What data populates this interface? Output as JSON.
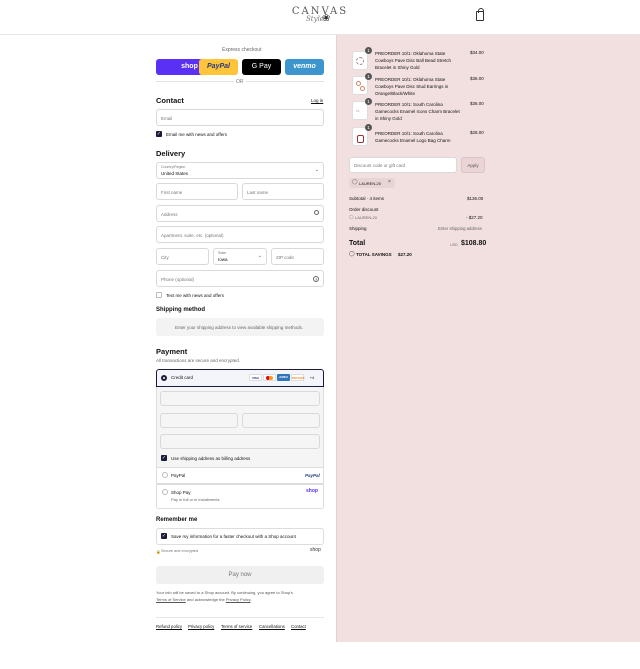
{
  "brand": {
    "logo_text": "CANVAS",
    "logo_sub": "Style"
  },
  "express": {
    "label": "Express checkout",
    "buttons": [
      "shop",
      "PayPal",
      "G Pay",
      "venmo"
    ],
    "or": "OR"
  },
  "contact": {
    "heading": "Contact",
    "login": "Log in",
    "email_placeholder": "Email",
    "email_news": "Email me with news and offers"
  },
  "delivery": {
    "heading": "Delivery",
    "country_label": "Country/Region",
    "country_value": "United States",
    "first_name": "First name",
    "last_name": "Last name",
    "address": "Address",
    "apartment": "Apartment, suite, etc. (optional)",
    "city": "City",
    "state_label": "State",
    "state_value": "Iowa",
    "zip": "ZIP code",
    "phone": "Phone (optional)",
    "text_news": "Text me with news and offers"
  },
  "shipping": {
    "heading": "Shipping method",
    "message": "Enter your shipping address to view available shipping methods."
  },
  "payment": {
    "heading": "Payment",
    "subtitle": "All transactions are secure and encrypted.",
    "credit_card": "Credit card",
    "more_cards": "+4",
    "card_brands": [
      "VISA",
      "MC",
      "AMEX",
      "DISCOVER"
    ],
    "billing_same": "Use shipping address as billing address",
    "paypal": "PayPal",
    "shop_pay": "Shop Pay",
    "shop_pay_sub": "Pay in full or in installments",
    "shop_logo": "shop"
  },
  "remember": {
    "heading": "Remember me",
    "save_info": "Save my information for a faster checkout with a Shop account",
    "secure": "Secure and encrypted",
    "shop": "shop"
  },
  "pay_now": "Pay now",
  "legal": {
    "line1": "Your info will be saved to a Shop account. By continuing, you agree to Shop's",
    "terms": "Terms of Service",
    "mid": " and acknowledge the ",
    "privacy": "Privacy Policy",
    "end": "."
  },
  "footer_links": [
    "Refund policy",
    "Privacy policy",
    "Terms of service",
    "Cancellations",
    "Contact"
  ],
  "cart": {
    "items": [
      {
        "qty": "1",
        "name1": "PREORDER 10/1: Oklahoma State",
        "name2": "Cowboys Pave Disc Ball Bead Stretch",
        "name3": "Bracelet in Shiny Gold",
        "price": "$34.00"
      },
      {
        "qty": "1",
        "name1": "PREORDER 10/1: Oklahoma State",
        "name2": "Cowboys Pave Disc Stud Earrings in",
        "name3": "Orange/Black/White",
        "price": "$36.00"
      },
      {
        "qty": "1",
        "name1": "PREORDER 10/1: South Carolina",
        "name2": "Gamecocks Enamel Icons Charm Bracelet",
        "name3": "in Shiny Gold",
        "price": "$36.00"
      },
      {
        "qty": "1",
        "name1": "PREORDER 10/1: South Carolina",
        "name2": "Gamecocks Enamel Logo Bag Charm",
        "name3": "",
        "price": "$28.00"
      }
    ],
    "discount_placeholder": "Discount code or gift card",
    "apply": "Apply",
    "code": "LAUREN-20",
    "subtotal_label": "Subtotal · 4 items",
    "subtotal": "$136.00",
    "order_discount": "Order discount",
    "discount_code": "LAUREN-20",
    "discount_amount": "- $27.20",
    "shipping_label": "Shipping",
    "shipping_value": "Enter shipping address",
    "total_label": "Total",
    "currency": "USD",
    "total": "$108.80",
    "savings_label": "TOTAL SAVINGS",
    "savings": "$27.20"
  }
}
